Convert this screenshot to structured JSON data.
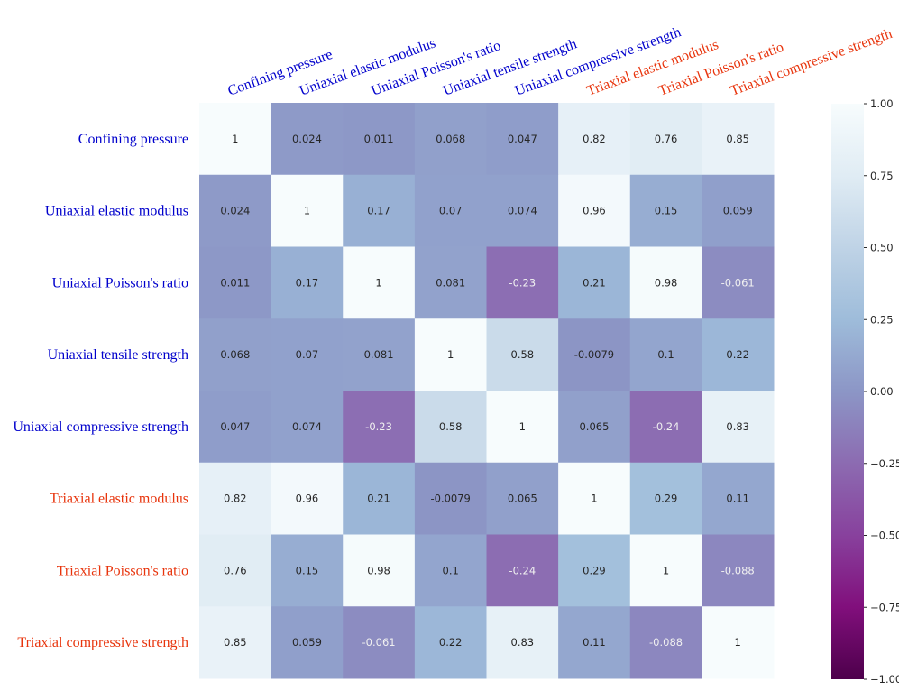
{
  "chart_data": {
    "type": "heatmap",
    "title": "",
    "colormap": "BuPu_r",
    "vmin": -1.0,
    "vmax": 1.0,
    "labels": [
      "Confining pressure",
      "Uniaxial elastic modulus",
      "Uniaxial Poisson's ratio",
      "Uniaxial tensile strength",
      "Uniaxial compressive strength",
      "Triaxial elastic modulus",
      "Triaxial Poisson's ratio",
      "Triaxial compressive strength"
    ],
    "label_groups": [
      "uniaxial",
      "uniaxial",
      "uniaxial",
      "uniaxial",
      "uniaxial",
      "triaxial",
      "triaxial",
      "triaxial"
    ],
    "group_colors": {
      "uniaxial": "#0000cc",
      "triaxial": "#e8340c"
    },
    "values": [
      [
        1,
        0.024,
        0.011,
        0.068,
        0.047,
        0.82,
        0.76,
        0.85
      ],
      [
        0.024,
        1,
        0.17,
        0.07,
        0.074,
        0.96,
        0.15,
        0.059
      ],
      [
        0.011,
        0.17,
        1,
        0.081,
        -0.23,
        0.21,
        0.98,
        -0.061
      ],
      [
        0.068,
        0.07,
        0.081,
        1,
        0.58,
        -0.0079,
        0.1,
        0.22
      ],
      [
        0.047,
        0.074,
        -0.23,
        0.58,
        1,
        0.065,
        -0.24,
        0.83
      ],
      [
        0.82,
        0.96,
        0.21,
        -0.0079,
        0.065,
        1,
        0.29,
        0.11
      ],
      [
        0.76,
        0.15,
        0.98,
        0.1,
        -0.24,
        0.29,
        1,
        -0.088
      ],
      [
        0.85,
        0.059,
        -0.061,
        0.22,
        0.83,
        0.11,
        -0.088,
        1
      ]
    ],
    "annotations": [
      [
        "1",
        "0.024",
        "0.011",
        "0.068",
        "0.047",
        "0.82",
        "0.76",
        "0.85"
      ],
      [
        "0.024",
        "1",
        "0.17",
        "0.07",
        "0.074",
        "0.96",
        "0.15",
        "0.059"
      ],
      [
        "0.011",
        "0.17",
        "1",
        "0.081",
        "-0.23",
        "0.21",
        "0.98",
        "-0.061"
      ],
      [
        "0.068",
        "0.07",
        "0.081",
        "1",
        "0.58",
        "-0.0079",
        "0.1",
        "0.22"
      ],
      [
        "0.047",
        "0.074",
        "-0.23",
        "0.58",
        "1",
        "0.065",
        "-0.24",
        "0.83"
      ],
      [
        "0.82",
        "0.96",
        "0.21",
        "-0.0079",
        "0.065",
        "1",
        "0.29",
        "0.11"
      ],
      [
        "0.76",
        "0.15",
        "0.98",
        "0.1",
        "-0.24",
        "0.29",
        "1",
        "-0.088"
      ],
      [
        "0.85",
        "0.059",
        "-0.061",
        "0.22",
        "0.83",
        "0.11",
        "-0.088",
        "1"
      ]
    ],
    "colorbar": {
      "ticks": [
        1.0,
        0.75,
        0.5,
        0.25,
        0.0,
        -0.25,
        -0.5,
        -0.75,
        -1.0
      ],
      "tick_labels": [
        "1.00",
        "0.75",
        "0.50",
        "0.25",
        "0.00",
        "−0.25",
        "−0.50",
        "−0.75",
        "−1.00"
      ],
      "placement": "right"
    },
    "xlabel": "",
    "ylabel": "",
    "x_tick_position": "top",
    "x_tick_rotation_deg": 20
  }
}
